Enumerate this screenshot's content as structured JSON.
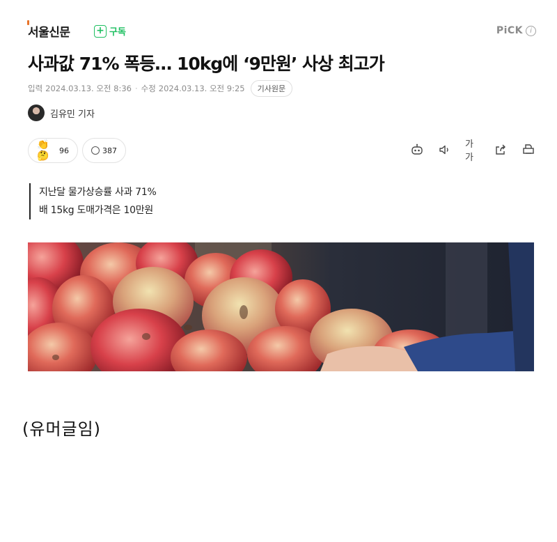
{
  "press": {
    "name": "서울신문",
    "subscribe_label": "구독",
    "pick_label": "PiCK"
  },
  "article": {
    "headline": "사과값 71% 폭등… 10kg에 ‘9만원’ 사상 최고가",
    "input_label": "입력",
    "input_date": "2024.03.13. 오전 8:36",
    "modified_label": "수정",
    "modified_date": "2024.03.13. 오전 9:25",
    "original_button": "기사원문",
    "reporter": "김유민 기자",
    "summary": [
      "지난달 물가상승률 사과 71%",
      "배 15kg 도매가격은 10만원"
    ]
  },
  "reactions": {
    "reaction_count": "96",
    "comment_count": "387",
    "font_size_label": "가가"
  },
  "overlay_text": "(유머글임)",
  "colors": {
    "accent_green": "#1dbf60",
    "logo_orange": "#e8742a"
  }
}
